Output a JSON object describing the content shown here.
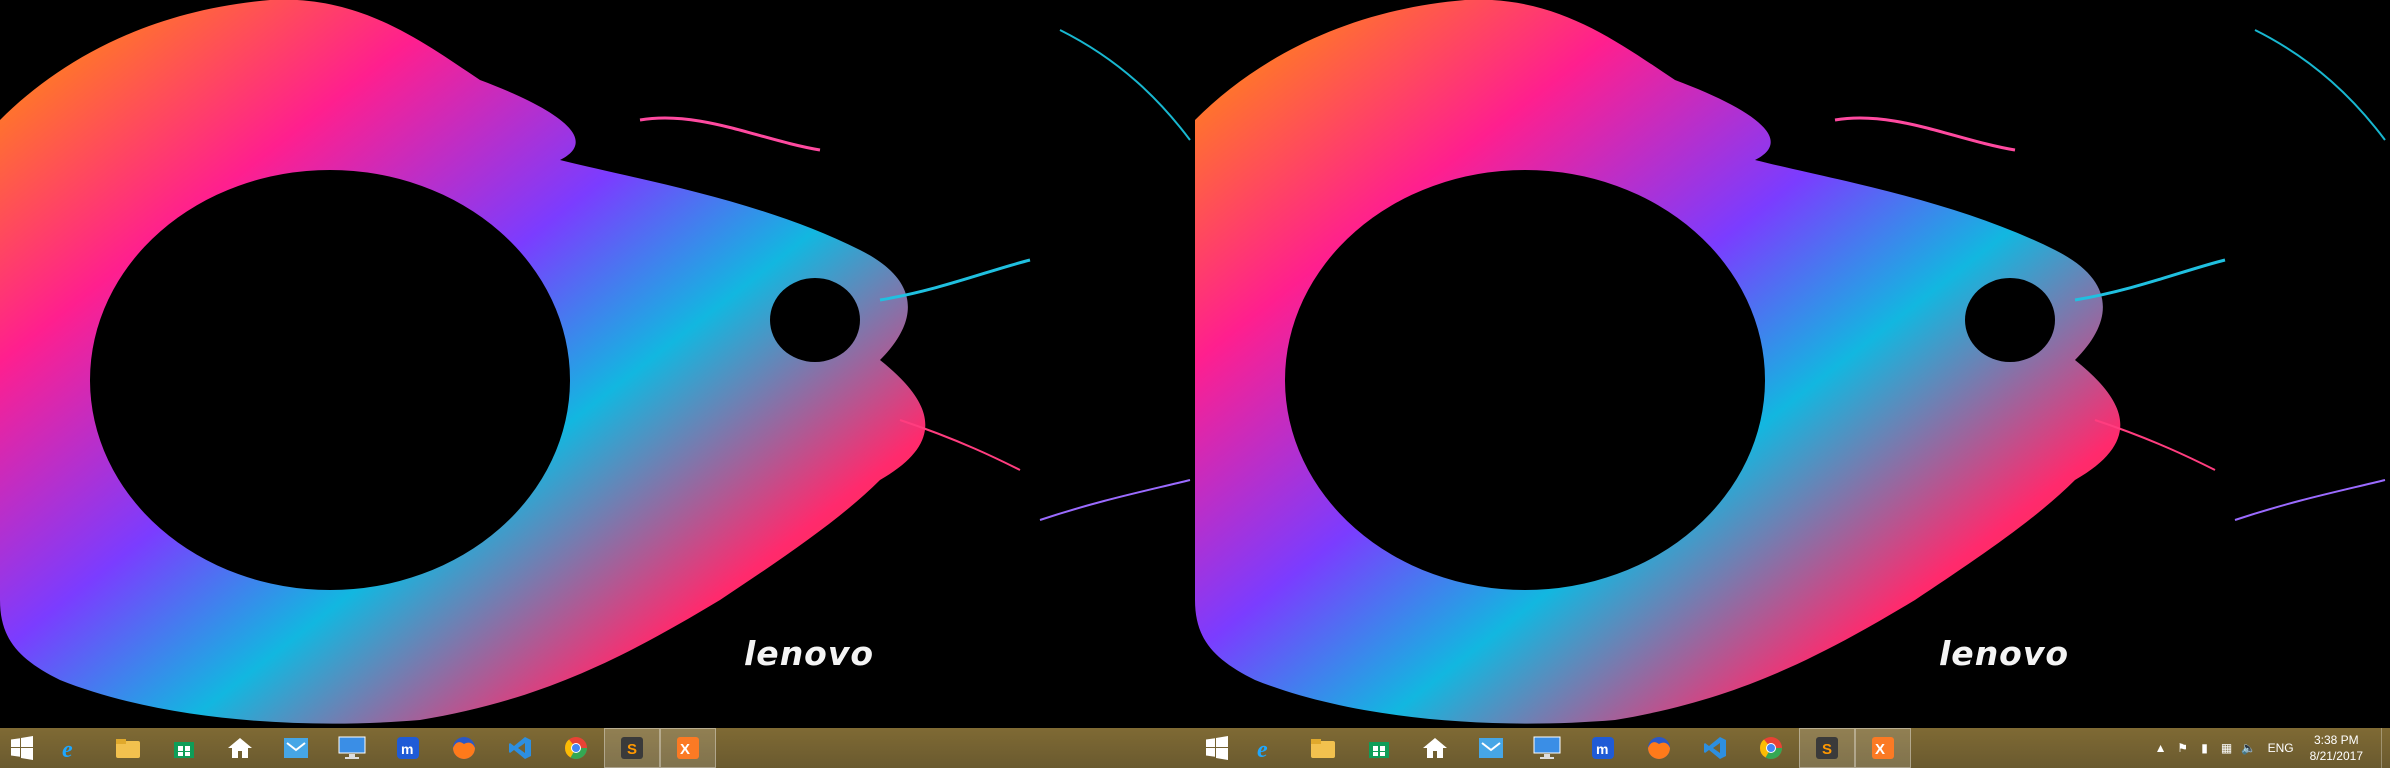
{
  "wallpaper": {
    "brand_text": "lenovo"
  },
  "taskbar": {
    "pinned": [
      {
        "name": "Internet Explorer",
        "icon": "internet-explorer-icon"
      },
      {
        "name": "File Explorer",
        "icon": "file-explorer-icon"
      },
      {
        "name": "Store",
        "icon": "store-icon"
      },
      {
        "name": "Home",
        "icon": "home-icon"
      },
      {
        "name": "Mail",
        "icon": "mail-icon"
      },
      {
        "name": "Remote Desktop",
        "icon": "monitor-icon"
      },
      {
        "name": "Maxthon",
        "icon": "maxthon-icon"
      },
      {
        "name": "Firefox",
        "icon": "firefox-icon"
      },
      {
        "name": "Visual Studio Code",
        "icon": "vscode-icon"
      },
      {
        "name": "Chrome",
        "icon": "chrome-icon"
      },
      {
        "name": "Sublime Text",
        "icon": "sublime-icon"
      },
      {
        "name": "XAMPP",
        "icon": "xampp-icon"
      }
    ],
    "tray": {
      "language": "ENG",
      "time": "3:38 PM",
      "date": "8/21/2017"
    }
  },
  "colors": {
    "taskbar": "#7a6633"
  }
}
